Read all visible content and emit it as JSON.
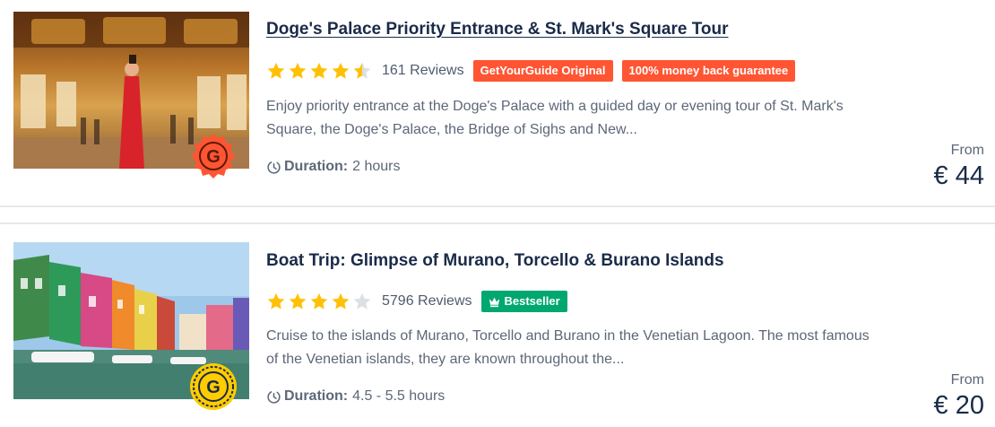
{
  "listings": [
    {
      "title": "Doge's Palace Priority Entrance & St. Mark's Square Tour",
      "rating": 4.5,
      "reviews": "161 Reviews",
      "tags": [
        "GetYourGuide Original",
        "100% money back guarantee"
      ],
      "description_line1": "Enjoy priority entrance at the Doge's Palace with a guided day or evening tour of St. Mark's",
      "description_line2": "Square, the Doge's Palace, the Bridge of Sighs and New...",
      "duration_label": "Duration:",
      "duration_value": "2 hours",
      "from_label": "From",
      "price": "€ 44",
      "badge_letter": "G",
      "badge_color": "#ff5533"
    },
    {
      "title": "Boat Trip: Glimpse of Murano, Torcello & Burano Islands",
      "rating": 4,
      "reviews": "5796 Reviews",
      "tags": [
        "Bestseller"
      ],
      "description_line1": "Cruise to the islands of Murano, Torcello and Burano in the Venetian Lagoon. The most famous",
      "description_line2": "of the Venetian islands, they are known throughout the...",
      "duration_label": "Duration:",
      "duration_value": "4.5 - 5.5 hours",
      "from_label": "From",
      "price": "€ 20",
      "badge_letter": "G",
      "badge_color": "#ffcc00"
    }
  ],
  "colors": {
    "star": "#ffc107",
    "star_empty": "#dcdfe4",
    "tag_red": "#ff5533",
    "tag_green": "#00a870",
    "title": "#1a2b49",
    "text": "#5d6778"
  },
  "icons": [
    "star-icon",
    "half-star-icon",
    "clock-icon",
    "crown-icon",
    "badge-icon"
  ]
}
